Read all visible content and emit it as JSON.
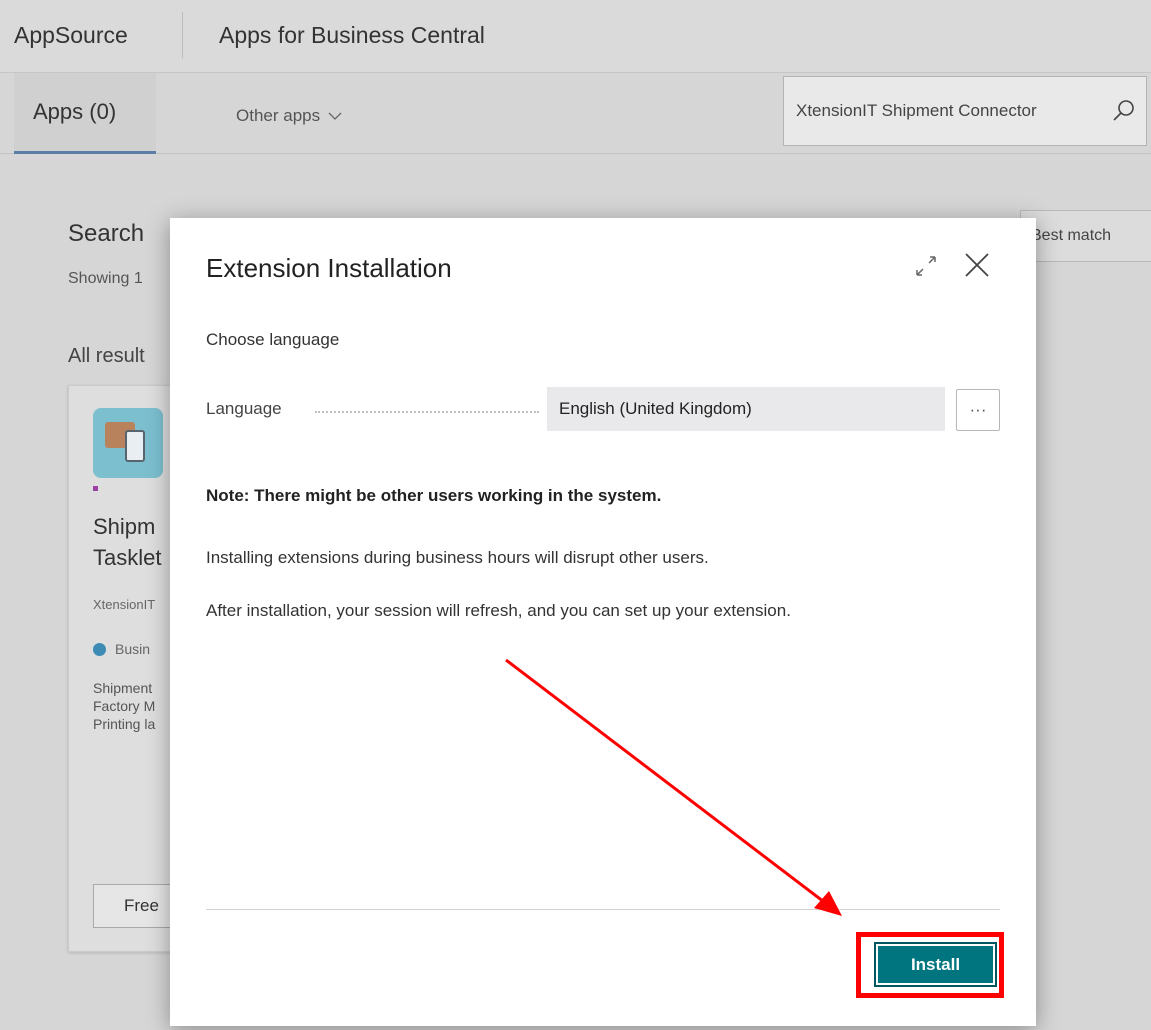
{
  "header": {
    "brand": "AppSource",
    "app_title": "Apps for Business Central"
  },
  "tabs": {
    "apps_label": "Apps  (0)",
    "other_apps_label": "Other apps"
  },
  "search": {
    "value": "XtensionIT Shipment Connector"
  },
  "results": {
    "title": "Search",
    "count": "Showing 1",
    "sort": "Best match",
    "all_results": "All result"
  },
  "card": {
    "title": "Shipm\nTasklet",
    "publisher": "XtensionIT",
    "category": "Busin",
    "description": "Shipment\nFactory M\nPrinting la",
    "button": "Free"
  },
  "dialog": {
    "title": "Extension Installation",
    "choose_language": "Choose language",
    "language_label": "Language",
    "language_value": "English (United Kingdom)",
    "more_label": "···",
    "note": "Note: There might be other users working in the system.",
    "paragraph1": "Installing extensions during business hours will disrupt other users.",
    "paragraph2": "After installation, your session will refresh, and you can set up your extension.",
    "install_label": "Install"
  },
  "colors": {
    "accent": "#00757f",
    "annotation": "#ff0000",
    "tab_underline": "#5b7fa6"
  }
}
